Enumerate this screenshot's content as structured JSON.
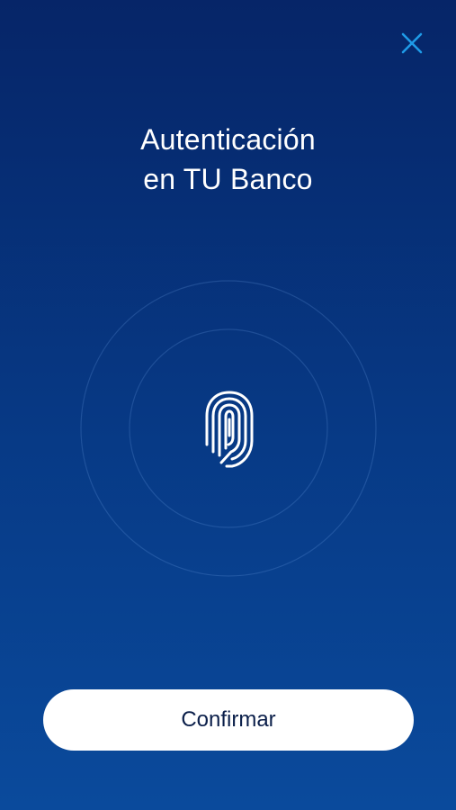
{
  "header": {
    "close_icon": "close-icon",
    "close_color": "#1e9be8"
  },
  "title": {
    "line1": "Autenticación",
    "line2": "en TU Banco"
  },
  "biometric": {
    "icon": "fingerprint-icon"
  },
  "actions": {
    "confirm_label": "Confirmar"
  },
  "colors": {
    "background_top": "#062568",
    "background_bottom": "#0a4a9c",
    "button_bg": "#ffffff",
    "button_text": "#0b1f4a"
  }
}
